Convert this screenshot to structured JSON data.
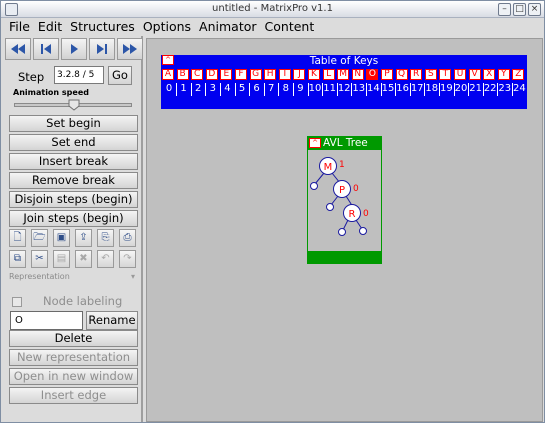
{
  "window": {
    "title": "untitled - MatrixPro v1.1"
  },
  "title_buttons": {
    "minimize": "–",
    "maximize": "□",
    "close": "×"
  },
  "menu": [
    "File",
    "Edit",
    "Structures",
    "Options",
    "Animator",
    "Content"
  ],
  "nav": [
    {
      "name": "rewind-to-start-icon",
      "glyph": "⏮"
    },
    {
      "name": "step-back-icon",
      "glyph": "◀"
    },
    {
      "name": "play-icon",
      "glyph": "▶"
    },
    {
      "name": "step-forward-icon",
      "glyph": "▶"
    },
    {
      "name": "fast-forward-icon",
      "glyph": "⏭"
    }
  ],
  "step": {
    "label": "Step",
    "value": "3.2.8 / 5",
    "go": "Go"
  },
  "animation_speed": {
    "label": "Animation speed",
    "value_fraction": 0.5
  },
  "buttons": {
    "set_begin": "Set begin",
    "set_end": "Set end",
    "insert_break": "Insert break",
    "remove_break": "Remove break",
    "disjoin_steps": "Disjoin steps (begin)",
    "join_steps": "Join steps (begin)",
    "delete": "Delete",
    "new_representation": "New representation",
    "open_new_window": "Open in new window",
    "insert_edge": "Insert edge"
  },
  "toolbar_row1": [
    "new-file-icon",
    "open-file-icon",
    "save-icon",
    "export-icon",
    "save-as-icon",
    "print-icon"
  ],
  "toolbar_row2": [
    "copy-icon",
    "cut-icon",
    "paste-icon",
    "trash-icon",
    "undo-icon",
    "redo-icon"
  ],
  "representation": {
    "label": "Representation"
  },
  "node_labeling": {
    "label": "Node labeling",
    "checked": false
  },
  "rename": {
    "value": "O",
    "button": "Rename"
  },
  "table_of_keys": {
    "title": "Table of Keys",
    "corner": "^",
    "keys": [
      "A",
      "B",
      "C",
      "D",
      "E",
      "F",
      "G",
      "H",
      "I",
      "J",
      "K",
      "L",
      "M",
      "N",
      "O",
      "P",
      "Q",
      "R",
      "S",
      "T",
      "U",
      "V",
      "X",
      "Y",
      "Z"
    ],
    "indices": [
      "0",
      "1",
      "2",
      "3",
      "4",
      "5",
      "6",
      "7",
      "8",
      "9",
      "10",
      "11",
      "12",
      "13",
      "14",
      "15",
      "16",
      "17",
      "18",
      "19",
      "20",
      "21",
      "22",
      "23",
      "24"
    ],
    "highlighted_index": 14
  },
  "avl_tree": {
    "title": "AVL Tree",
    "corner": "^",
    "nodes": [
      {
        "key": "M",
        "balance": "1"
      },
      {
        "key": "P",
        "balance": "0"
      },
      {
        "key": "R",
        "balance": "0"
      }
    ]
  },
  "colors": {
    "keys_bg": "#0000f0",
    "key_border": "#ff0000",
    "highlight": "#ff0000",
    "avl_accent": "#009900",
    "canvas_bg": "#bfbfbf"
  }
}
